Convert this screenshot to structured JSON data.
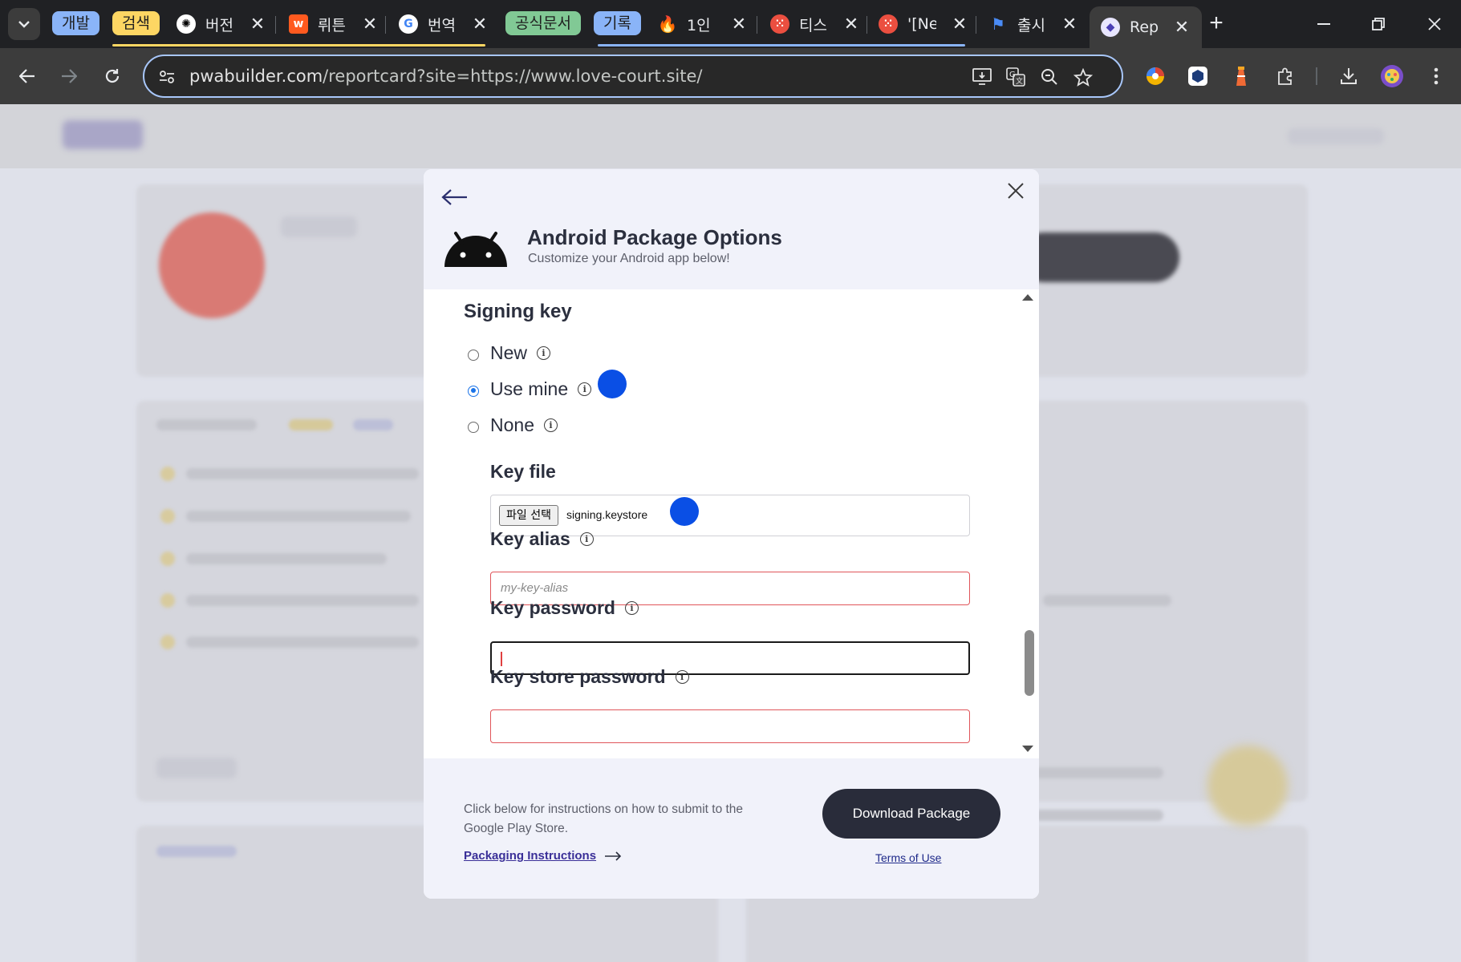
{
  "browser": {
    "tab_groups": [
      {
        "label": "개발",
        "color": "#8ab4f8"
      },
      {
        "label": "검색",
        "color": "#fdd663"
      },
      {
        "label": "공식문서",
        "color": "#81c995"
      },
      {
        "label": "기록",
        "color": "#8ab4f8"
      }
    ],
    "tabs": [
      {
        "title": "버전",
        "icon": "openai-icon"
      },
      {
        "title": "뤼튼",
        "icon": "wrtn-icon"
      },
      {
        "title": "번역",
        "icon": "google-icon"
      },
      {
        "title": "1인",
        "icon": "fire-icon"
      },
      {
        "title": "티스",
        "icon": "tistory-icon"
      },
      {
        "title": "'[Ne",
        "icon": "tistory-icon"
      },
      {
        "title": "출시",
        "icon": "flag-icon"
      },
      {
        "title": "Rep",
        "icon": "pwabuilder-icon",
        "active": true
      }
    ],
    "address": {
      "host": "pwabuilder.com",
      "path": "/reportcard?site=https://www.love-court.site/"
    }
  },
  "modal": {
    "title": "Android Package Options",
    "subtitle": "Customize your Android app below!",
    "signing_key": {
      "heading": "Signing key",
      "options": [
        {
          "label": "New",
          "selected": false
        },
        {
          "label": "Use mine",
          "selected": true
        },
        {
          "label": "None",
          "selected": false
        }
      ]
    },
    "key_file": {
      "label": "Key file",
      "button": "파일 선택",
      "file_name": "signing.keystore"
    },
    "key_alias": {
      "label": "Key alias",
      "placeholder": "my-key-alias",
      "value": ""
    },
    "key_password": {
      "label": "Key password",
      "value": ""
    },
    "key_store_password": {
      "label": "Key store password",
      "value": ""
    },
    "footer": {
      "instructions_text": "Click below for instructions on how to submit to the Google Play Store.",
      "instructions_link": "Packaging Instructions",
      "download_button": "Download Package",
      "terms_link": "Terms of Use"
    }
  },
  "colors": {
    "accent": "#292c3a",
    "link": "#3a2f98",
    "error_border": "#e0555a",
    "marker_blue": "#0a4fe5"
  }
}
